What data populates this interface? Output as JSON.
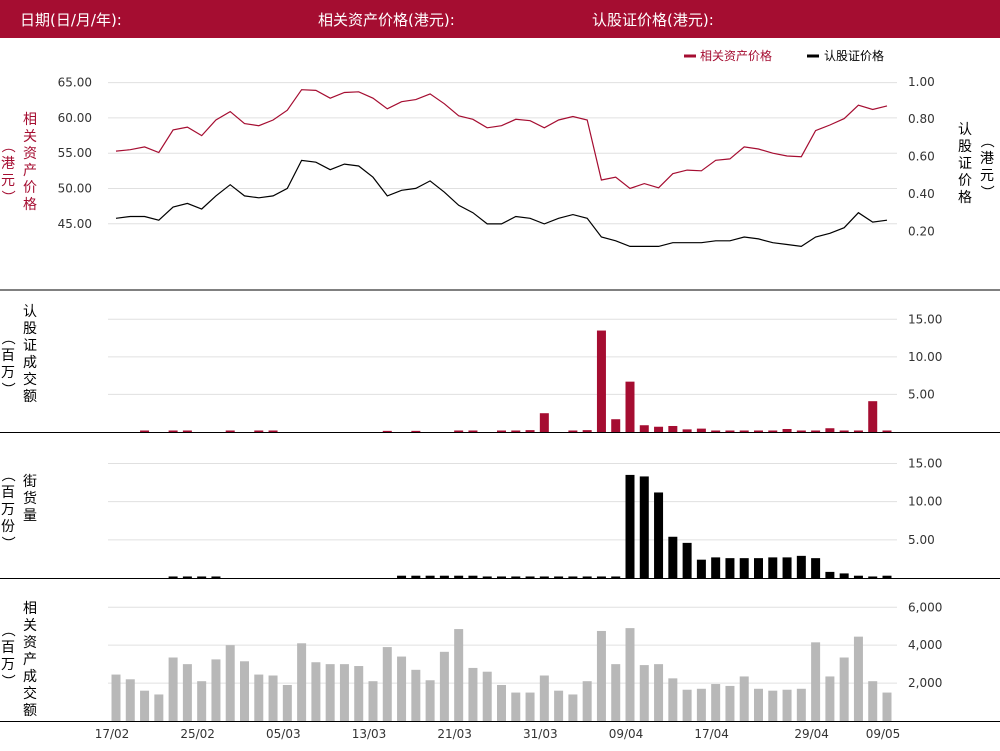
{
  "header": {
    "date_label": "日期(日/月/年):",
    "underlying_price_label": "相关资产价格(港元):",
    "warrant_price_label": "认股证价格(港元):"
  },
  "colors": {
    "brand": "#a50d31",
    "underlying": "#a50d31",
    "warrant": "#000000",
    "underlying_turnover": "#b8b8b8",
    "grid": "#e0e0e0"
  },
  "chart_data": [
    {
      "type": "line",
      "legend": [
        "相关资产价格",
        "认股证价格"
      ],
      "legend_position": "top-right",
      "ylabel_left": "相关资产价格（港元）",
      "ylabel_right": "认股证价格（港元）",
      "left_ticks": [
        "65.00",
        "60.00",
        "55.00",
        "50.00",
        "45.00"
      ],
      "right_ticks": [
        "1.00",
        "0.80",
        "0.60",
        "0.40",
        "0.20"
      ],
      "ylim_left": [
        41,
        67.5
      ],
      "ylim_right": [
        0.09,
        1.09
      ],
      "series": [
        {
          "name": "相关资产价格",
          "axis": "left",
          "values": [
            55.3,
            55.5,
            55.9,
            55.1,
            58.3,
            58.7,
            57.5,
            59.7,
            60.9,
            59.2,
            58.9,
            59.7,
            61.1,
            64.0,
            63.9,
            62.8,
            63.6,
            63.7,
            62.8,
            61.3,
            62.3,
            62.6,
            63.4,
            62.0,
            60.3,
            59.8,
            58.6,
            58.9,
            59.8,
            59.6,
            58.6,
            59.7,
            60.2,
            59.7,
            51.2,
            51.6,
            50.0,
            50.7,
            50.1,
            52.1,
            52.6,
            52.5,
            54.0,
            54.2,
            55.9,
            55.6,
            55.0,
            54.6,
            54.5,
            58.2,
            59.0,
            59.9,
            61.8,
            61.2,
            61.7
          ]
        },
        {
          "name": "认股证价格",
          "axis": "right",
          "values": [
            0.27,
            0.28,
            0.28,
            0.26,
            0.33,
            0.35,
            0.32,
            0.39,
            0.45,
            0.39,
            0.38,
            0.39,
            0.43,
            0.58,
            0.57,
            0.53,
            0.56,
            0.55,
            0.49,
            0.39,
            0.42,
            0.43,
            0.47,
            0.41,
            0.34,
            0.3,
            0.24,
            0.24,
            0.28,
            0.27,
            0.24,
            0.27,
            0.29,
            0.27,
            0.17,
            0.15,
            0.12,
            0.12,
            0.12,
            0.14,
            0.14,
            0.14,
            0.15,
            0.15,
            0.17,
            0.16,
            0.14,
            0.13,
            0.12,
            0.17,
            0.19,
            0.22,
            0.3,
            0.25,
            0.26
          ]
        }
      ]
    },
    {
      "type": "bar",
      "ylabel": "认股证成交额（百万）",
      "ticks": [
        "15.00",
        "10.00",
        "5.00"
      ],
      "ylim": [
        0,
        16.5
      ],
      "color": "#a50d31",
      "values": [
        0,
        0,
        0.2,
        0,
        0.2,
        0.2,
        0,
        0,
        0.2,
        0,
        0.2,
        0.2,
        0,
        0,
        0,
        0,
        0,
        0,
        0,
        0.15,
        0,
        0.15,
        0,
        0,
        0.2,
        0.2,
        0,
        0.2,
        0.2,
        0.25,
        2.5,
        0,
        0.2,
        0.25,
        13.5,
        1.7,
        6.7,
        0.9,
        0.7,
        0.8,
        0.35,
        0.45,
        0.2,
        0.2,
        0.2,
        0.2,
        0.2,
        0.4,
        0.2,
        0.2,
        0.5,
        0.2,
        0.2,
        4.1,
        0.2
      ]
    },
    {
      "type": "bar",
      "ylabel": "街货量（百万份）",
      "ticks": [
        "15.00",
        "10.00",
        "5.00"
      ],
      "ylim": [
        0,
        16.5
      ],
      "color": "#000000",
      "values": [
        0,
        0,
        0,
        0,
        0.2,
        0.2,
        0.2,
        0.2,
        0,
        0,
        0,
        0,
        0,
        0,
        0,
        0,
        0,
        0,
        0,
        0,
        0.3,
        0.3,
        0.3,
        0.3,
        0.3,
        0.3,
        0.2,
        0.2,
        0.2,
        0.2,
        0.2,
        0.2,
        0.2,
        0.2,
        0.2,
        0.2,
        13.5,
        13.3,
        11.2,
        5.4,
        4.6,
        2.4,
        2.7,
        2.6,
        2.6,
        2.6,
        2.7,
        2.7,
        2.9,
        2.6,
        0.8,
        0.6,
        0.3,
        0.2,
        0.3
      ]
    },
    {
      "type": "bar",
      "ylabel": "相关资产成交额（百万）",
      "ticks": [
        "6,000",
        "4,000",
        "2,000"
      ],
      "ylim": [
        0,
        6700
      ],
      "color": "#b8b8b8",
      "values": [
        2450,
        2200,
        1600,
        1400,
        3350,
        3000,
        2100,
        3250,
        4000,
        3150,
        2450,
        2400,
        1900,
        4100,
        3100,
        3000,
        3000,
        2900,
        2100,
        3900,
        3400,
        2700,
        2150,
        3650,
        4850,
        2800,
        2600,
        1900,
        1500,
        1500,
        2400,
        1600,
        1400,
        2100,
        4750,
        3000,
        4900,
        2950,
        3000,
        2250,
        1650,
        1700,
        1950,
        1850,
        2350,
        1700,
        1600,
        1650,
        1700,
        4150,
        2350,
        3350,
        4450,
        2100,
        1500
      ]
    }
  ],
  "x_axis": {
    "tick_labels": [
      "17/02",
      "25/02",
      "05/03",
      "13/03",
      "21/03",
      "31/03",
      "09/04",
      "17/04",
      "29/04",
      "09/05"
    ],
    "tick_index": [
      0,
      6,
      12,
      18,
      24,
      30,
      36,
      42,
      49,
      54
    ]
  }
}
